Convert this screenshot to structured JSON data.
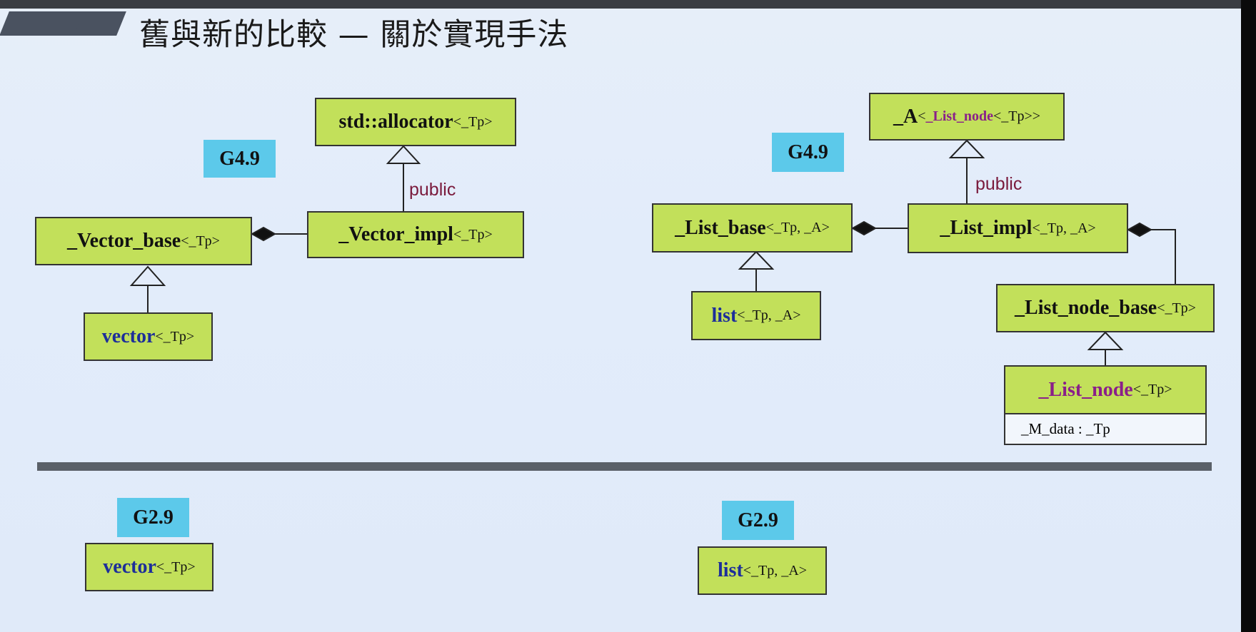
{
  "title": "舊與新的比較 — 關於實現手法",
  "badges": {
    "left_top": "G4.9",
    "right_top": "G4.9",
    "left_bottom": "G2.9",
    "right_bottom": "G2.9"
  },
  "labels": {
    "public_left": "public",
    "public_right": "public"
  },
  "vector_side": {
    "allocator": {
      "name": "std::allocator",
      "param": "<_Tp>"
    },
    "vector_impl": {
      "name": "_Vector_impl",
      "param": "<_Tp>"
    },
    "vector_base": {
      "name": "_Vector_base",
      "param": "<_Tp>"
    },
    "vector": {
      "name": "vector",
      "param": "<_Tp>"
    }
  },
  "list_side": {
    "alloc": {
      "name": "_A",
      "open": "<",
      "inner": "_List_node",
      "close": "<_Tp>>"
    },
    "list_base": {
      "name": "_List_base",
      "param": "<_Tp, _A>"
    },
    "list_impl": {
      "name": "_List_impl",
      "param": "<_Tp, _A>"
    },
    "list": {
      "name": "list",
      "param": "<_Tp, _A>"
    },
    "list_node_base": {
      "name": "_List_node_base",
      "param": "<_Tp>"
    },
    "list_node": {
      "name": "_List_node",
      "param": "<_Tp>",
      "attr": "_M_data : _Tp"
    }
  },
  "old": {
    "vector": {
      "name": "vector",
      "param": "<_Tp>"
    },
    "list": {
      "name": "list",
      "param": "<_Tp, _A>"
    }
  },
  "colors": {
    "box_fill": "#c2e05a",
    "badge_fill": "#5cc9ea",
    "class_blue": "#1d2e9a",
    "class_purple": "#8a1f8a",
    "public_label": "#7a1a3c"
  }
}
